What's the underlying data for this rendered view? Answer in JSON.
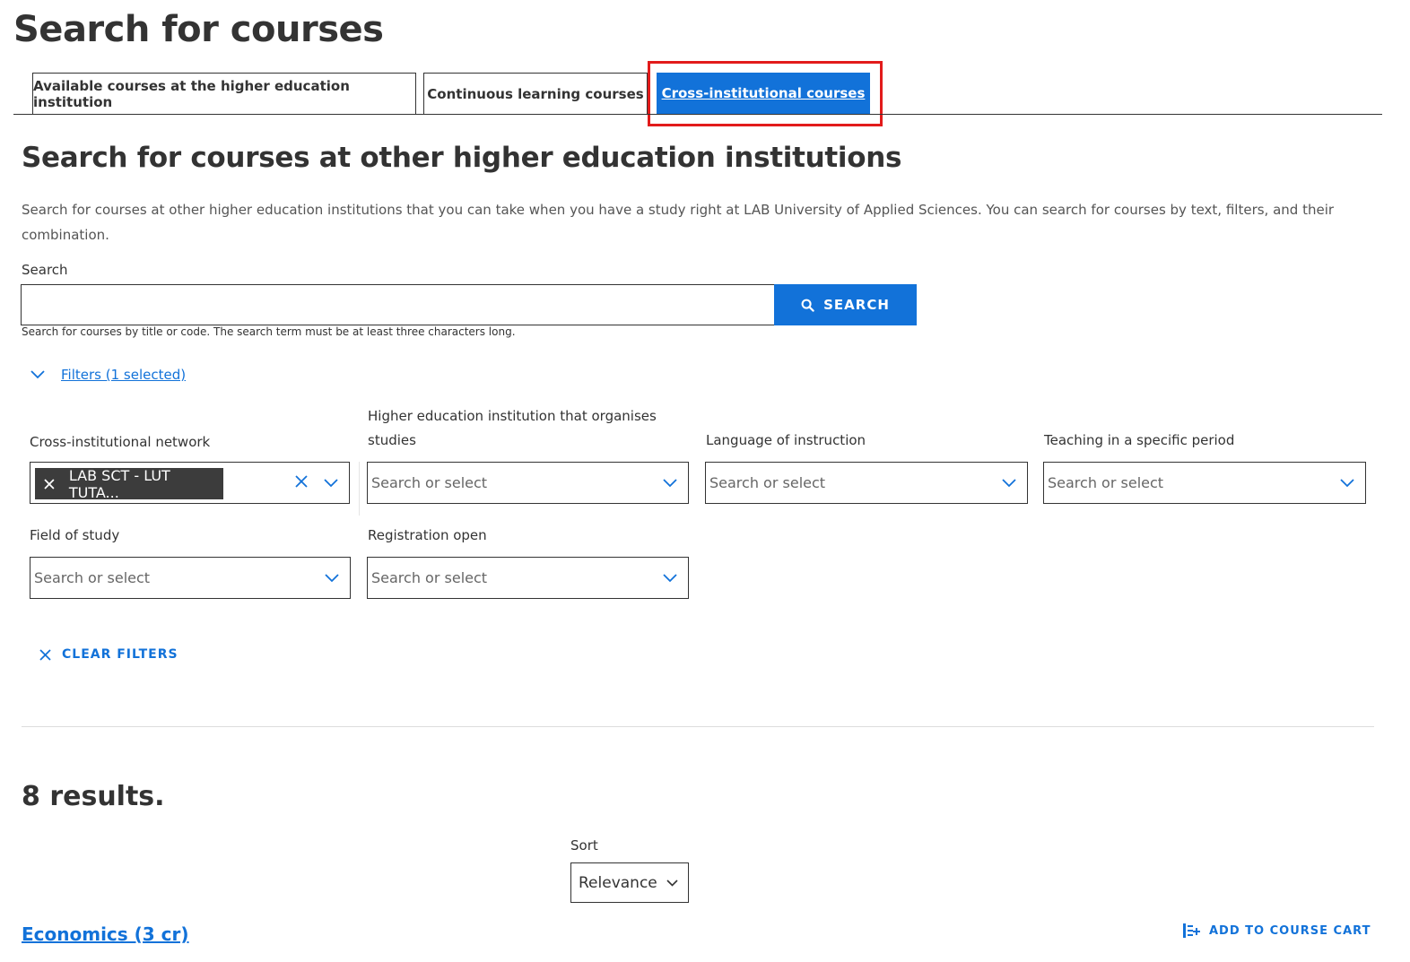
{
  "page": {
    "title": "Search for courses"
  },
  "tabs": [
    {
      "label": "Available courses at the higher education institution",
      "active": false
    },
    {
      "label": "Continuous learning courses",
      "active": false
    },
    {
      "label": "Cross-institutional courses",
      "active": true
    }
  ],
  "section": {
    "title": "Search for courses at other higher education institutions",
    "description": "Search for courses at other higher education institutions that you can take when you have a study right at LAB University of Applied Sciences. You can search for courses by text, filters, and their combination."
  },
  "search": {
    "label": "Search",
    "value": "",
    "button_label": "SEARCH",
    "hint": "Search for courses by title or code. The search term must be at least three characters long."
  },
  "filters": {
    "toggle_label": "Filters (1 selected)",
    "items": [
      {
        "label": "Cross-institutional network",
        "selected_chip": "LAB SCT - LUT TUTA..."
      },
      {
        "label": "Higher education institution that organises studies",
        "placeholder": "Search or select"
      },
      {
        "label": "Language of instruction",
        "placeholder": "Search or select"
      },
      {
        "label": "Teaching in a specific period",
        "placeholder": "Search or select"
      },
      {
        "label": "Field of study",
        "placeholder": "Search or select"
      },
      {
        "label": "Registration open",
        "placeholder": "Search or select"
      }
    ],
    "clear_label": "CLEAR FILTERS"
  },
  "results": {
    "count_text": "8 results.",
    "sort_label": "Sort",
    "sort_value": "Relevance",
    "first_course": "Economics (3 cr)",
    "add_to_cart_label": "ADD TO COURSE CART"
  },
  "colors": {
    "accent": "#1272d9",
    "highlight": "#e21b1b",
    "chip": "#3c3c3c"
  }
}
